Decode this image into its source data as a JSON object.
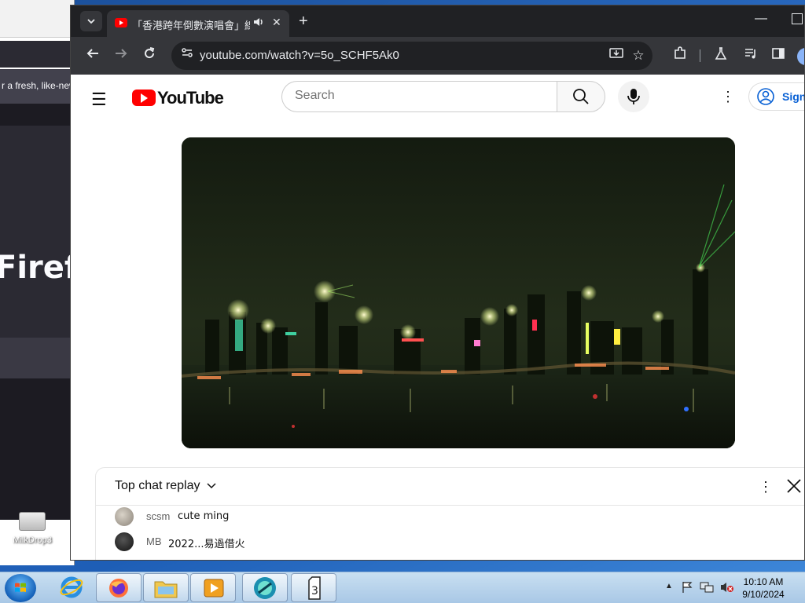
{
  "background_window": {
    "notice_text": "r a fresh, like-new",
    "hero_text": "Firefo"
  },
  "desktop": {
    "icons": [
      {
        "label": "MilkDrop3"
      }
    ]
  },
  "chrome": {
    "tab": {
      "title": "「香港跨年倒數演唱會」線上"
    },
    "address": {
      "url": "youtube.com/watch?v=5o_SCHF5Ak0"
    }
  },
  "youtube": {
    "logo_text": "YouTube",
    "search": {
      "placeholder": "Search",
      "value": ""
    },
    "sign_in_label": "Sign",
    "chat": {
      "header_label": "Top chat replay",
      "messages": [
        {
          "author": "scsm",
          "text": "cute ming"
        },
        {
          "author": "MB",
          "text": "2022...易過借火"
        }
      ]
    }
  },
  "taskbar": {
    "clock": {
      "time": "10:10 AM",
      "date": "9/10/2024"
    },
    "open_windows": [
      "internet-explorer",
      "firefox",
      "windows-explorer",
      "media-player",
      "chrome-app",
      "milkdrop"
    ]
  },
  "colors": {
    "youtube_red": "#ff0000",
    "chrome_dark": "#35363a",
    "link_blue": "#065fd4",
    "taskbar": "#b7d3ee"
  },
  "icons": [
    "windows-start-icon",
    "internet-explorer-icon",
    "firefox-icon",
    "folder-icon",
    "media-player-icon",
    "app-icon",
    "milkdrop-icon"
  ]
}
